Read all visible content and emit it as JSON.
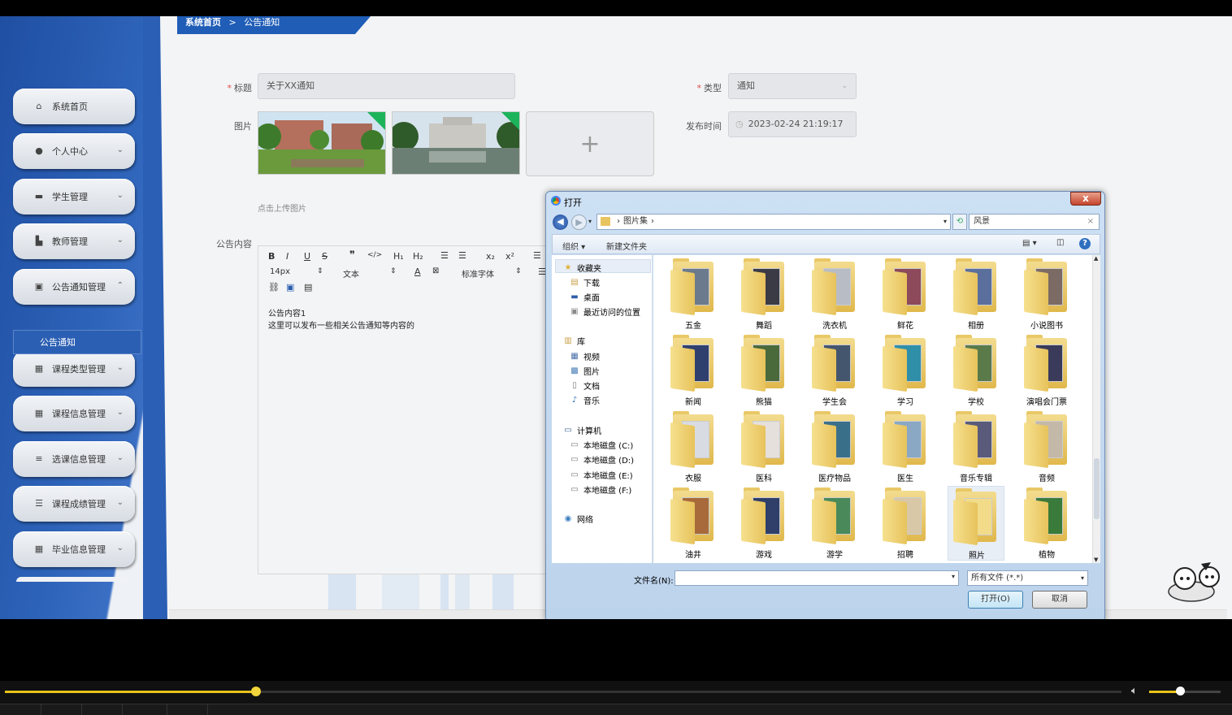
{
  "breadcrumb": {
    "home": "系统首页",
    "sep": ">",
    "current": "公告通知"
  },
  "sidebar": {
    "items": [
      {
        "label": "系统首页",
        "icon": "home-icon",
        "glyph": "⌂",
        "chev": ""
      },
      {
        "label": "个人中心",
        "icon": "user-icon",
        "glyph": "●",
        "chev": "⌄"
      },
      {
        "label": "学生管理",
        "icon": "student-icon",
        "glyph": "▬",
        "chev": "⌄"
      },
      {
        "label": "教师管理",
        "icon": "teacher-icon",
        "glyph": "▙",
        "chev": "⌄"
      },
      {
        "label": "公告通知管理",
        "icon": "notice-icon",
        "glyph": "▣",
        "chev": "⌃"
      },
      {
        "label": "课程类型管理",
        "icon": "grid-icon",
        "glyph": "▦",
        "chev": "⌄"
      },
      {
        "label": "课程信息管理",
        "icon": "grid-icon",
        "glyph": "▦",
        "chev": "⌄"
      },
      {
        "label": "选课信息管理",
        "icon": "sliders-icon",
        "glyph": "≡",
        "chev": "⌄"
      },
      {
        "label": "课程成绩管理",
        "icon": "list-icon",
        "glyph": "☰",
        "chev": "⌄"
      },
      {
        "label": "毕业信息管理",
        "icon": "grid-icon",
        "glyph": "▦",
        "chev": "⌄"
      }
    ],
    "submenu": "公告通知"
  },
  "form": {
    "title_label": "标题",
    "title_value": "关于XX通知",
    "type_label": "类型",
    "type_value": "通知",
    "image_label": "图片",
    "upload_plus": "+",
    "upload_hint": "点击上传图片",
    "time_label": "发布时间",
    "time_value": "2023-02-24 21:19:17",
    "content_label": "公告内容",
    "req": "*"
  },
  "editor": {
    "font_size": "14px",
    "text_type": "文本",
    "font_family": "标准字体",
    "content_line1": "公告内容1",
    "content_line2": "这里可以发布一些相关公告通知等内容的"
  },
  "dialog": {
    "title": "打开",
    "close": "x",
    "path": "图片集",
    "search": "风景",
    "organize": "组织 ▾",
    "new_folder": "新建文件夹",
    "nav": [
      {
        "label": "收藏夹",
        "icon": "star-icon",
        "glyph": "★",
        "color": "#e2b13c"
      },
      {
        "label": "下载",
        "icon": "download-folder-icon",
        "glyph": "▤",
        "color": "#caa24a"
      },
      {
        "label": "桌面",
        "icon": "desktop-icon",
        "glyph": "▬",
        "color": "#2f5da8"
      },
      {
        "label": "最近访问的位置",
        "icon": "recent-icon",
        "glyph": "▣",
        "color": "#8a8a8a"
      },
      {
        "label": "库",
        "icon": "library-icon",
        "glyph": "▥",
        "color": "#caa24a"
      },
      {
        "label": "视频",
        "icon": "video-icon",
        "glyph": "▦",
        "color": "#4a6fa8"
      },
      {
        "label": "图片",
        "icon": "picture-icon",
        "glyph": "▩",
        "color": "#4a7fb8"
      },
      {
        "label": "文档",
        "icon": "document-icon",
        "glyph": "▯",
        "color": "#777"
      },
      {
        "label": "音乐",
        "icon": "music-icon",
        "glyph": "♪",
        "color": "#2f6fb8"
      },
      {
        "label": "计算机",
        "icon": "computer-icon",
        "glyph": "▭",
        "color": "#3b5f91"
      },
      {
        "label": "本地磁盘 (C:)",
        "icon": "drive-c-icon",
        "glyph": "▭",
        "color": "#777"
      },
      {
        "label": "本地磁盘 (D:)",
        "icon": "drive-icon",
        "glyph": "▭",
        "color": "#777"
      },
      {
        "label": "本地磁盘 (E:)",
        "icon": "drive-icon",
        "glyph": "▭",
        "color": "#777"
      },
      {
        "label": "本地磁盘 (F:)",
        "icon": "drive-icon",
        "glyph": "▭",
        "color": "#777"
      },
      {
        "label": "网络",
        "icon": "network-icon",
        "glyph": "◉",
        "color": "#3a7fbf"
      }
    ],
    "folders": [
      {
        "name": "五金",
        "color": "#6b7a8c"
      },
      {
        "name": "舞蹈",
        "color": "#3b3b46"
      },
      {
        "name": "洗衣机",
        "color": "#b8bcc4"
      },
      {
        "name": "鲜花",
        "color": "#8c4a5a"
      },
      {
        "name": "相册",
        "color": "#5a6f9c"
      },
      {
        "name": "小说图书",
        "color": "#7c6a64"
      },
      {
        "name": "新闻",
        "color": "#2f3f6e"
      },
      {
        "name": "熊猫",
        "color": "#4a6a3c"
      },
      {
        "name": "学生会",
        "color": "#44556e"
      },
      {
        "name": "学习",
        "color": "#2f8fa8"
      },
      {
        "name": "学校",
        "color": "#5a7a4a"
      },
      {
        "name": "演唱会门票",
        "color": "#3a3a5a"
      },
      {
        "name": "衣服",
        "color": "#d8dce2"
      },
      {
        "name": "医科",
        "color": "#e6e0dc"
      },
      {
        "name": "医疗物品",
        "color": "#3a6f8a"
      },
      {
        "name": "医生",
        "color": "#8aa8c4"
      },
      {
        "name": "音乐专辑",
        "color": "#5a5a7a"
      },
      {
        "name": "音频",
        "color": "#c4b8a8"
      },
      {
        "name": "油井",
        "color": "#a86a3a"
      },
      {
        "name": "游戏",
        "color": "#2f3f6a"
      },
      {
        "name": "游学",
        "color": "#4a8a5a"
      },
      {
        "name": "招聘",
        "color": "#d8c8a8"
      },
      {
        "name": "照片",
        "color": "#f2dc8a"
      },
      {
        "name": "植物",
        "color": "#3a7a3a"
      }
    ],
    "filename_label": "文件名(N):",
    "filetype": "所有文件 (*.*)",
    "open_button": "打开(O)",
    "cancel_button": "取消"
  },
  "player": {
    "progress": 0.225,
    "volume": 0.43
  }
}
